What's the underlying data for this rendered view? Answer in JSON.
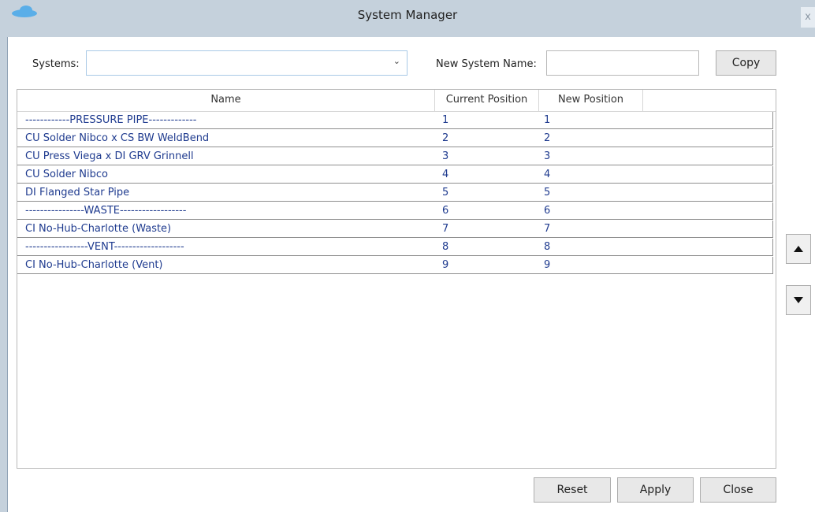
{
  "window": {
    "title": "System Manager",
    "close_glyph": "x",
    "icon": "cloud-icon"
  },
  "toolbar": {
    "systems_label": "Systems:",
    "systems_value": "",
    "new_name_label": "New System Name:",
    "new_name_value": "",
    "copy_label": "Copy"
  },
  "grid": {
    "columns": [
      "Name",
      "Current Position",
      "New Position"
    ],
    "rows": [
      {
        "name": "------------PRESSURE PIPE-------------",
        "current": "1",
        "new": "1"
      },
      {
        "name": "CU Solder Nibco x CS BW WeldBend",
        "current": "2",
        "new": "2"
      },
      {
        "name": "CU Press Viega x DI GRV Grinnell",
        "current": "3",
        "new": "3"
      },
      {
        "name": "CU Solder Nibco",
        "current": "4",
        "new": "4"
      },
      {
        "name": "DI Flanged Star Pipe",
        "current": "5",
        "new": "5"
      },
      {
        "name": "----------------WASTE------------------",
        "current": "6",
        "new": "6"
      },
      {
        "name": "CI No-Hub-Charlotte (Waste)",
        "current": "7",
        "new": "7"
      },
      {
        "name": "-----------------VENT-------------------",
        "current": "8",
        "new": "8"
      },
      {
        "name": "CI No-Hub-Charlotte (Vent)",
        "current": "9",
        "new": "9"
      }
    ],
    "text_color": "#1f3b8f"
  },
  "side_buttons": {
    "up_icon": "triangle-up-icon",
    "down_icon": "triangle-down-icon"
  },
  "footer": {
    "reset_label": "Reset",
    "apply_label": "Apply",
    "close_label": "Close"
  }
}
